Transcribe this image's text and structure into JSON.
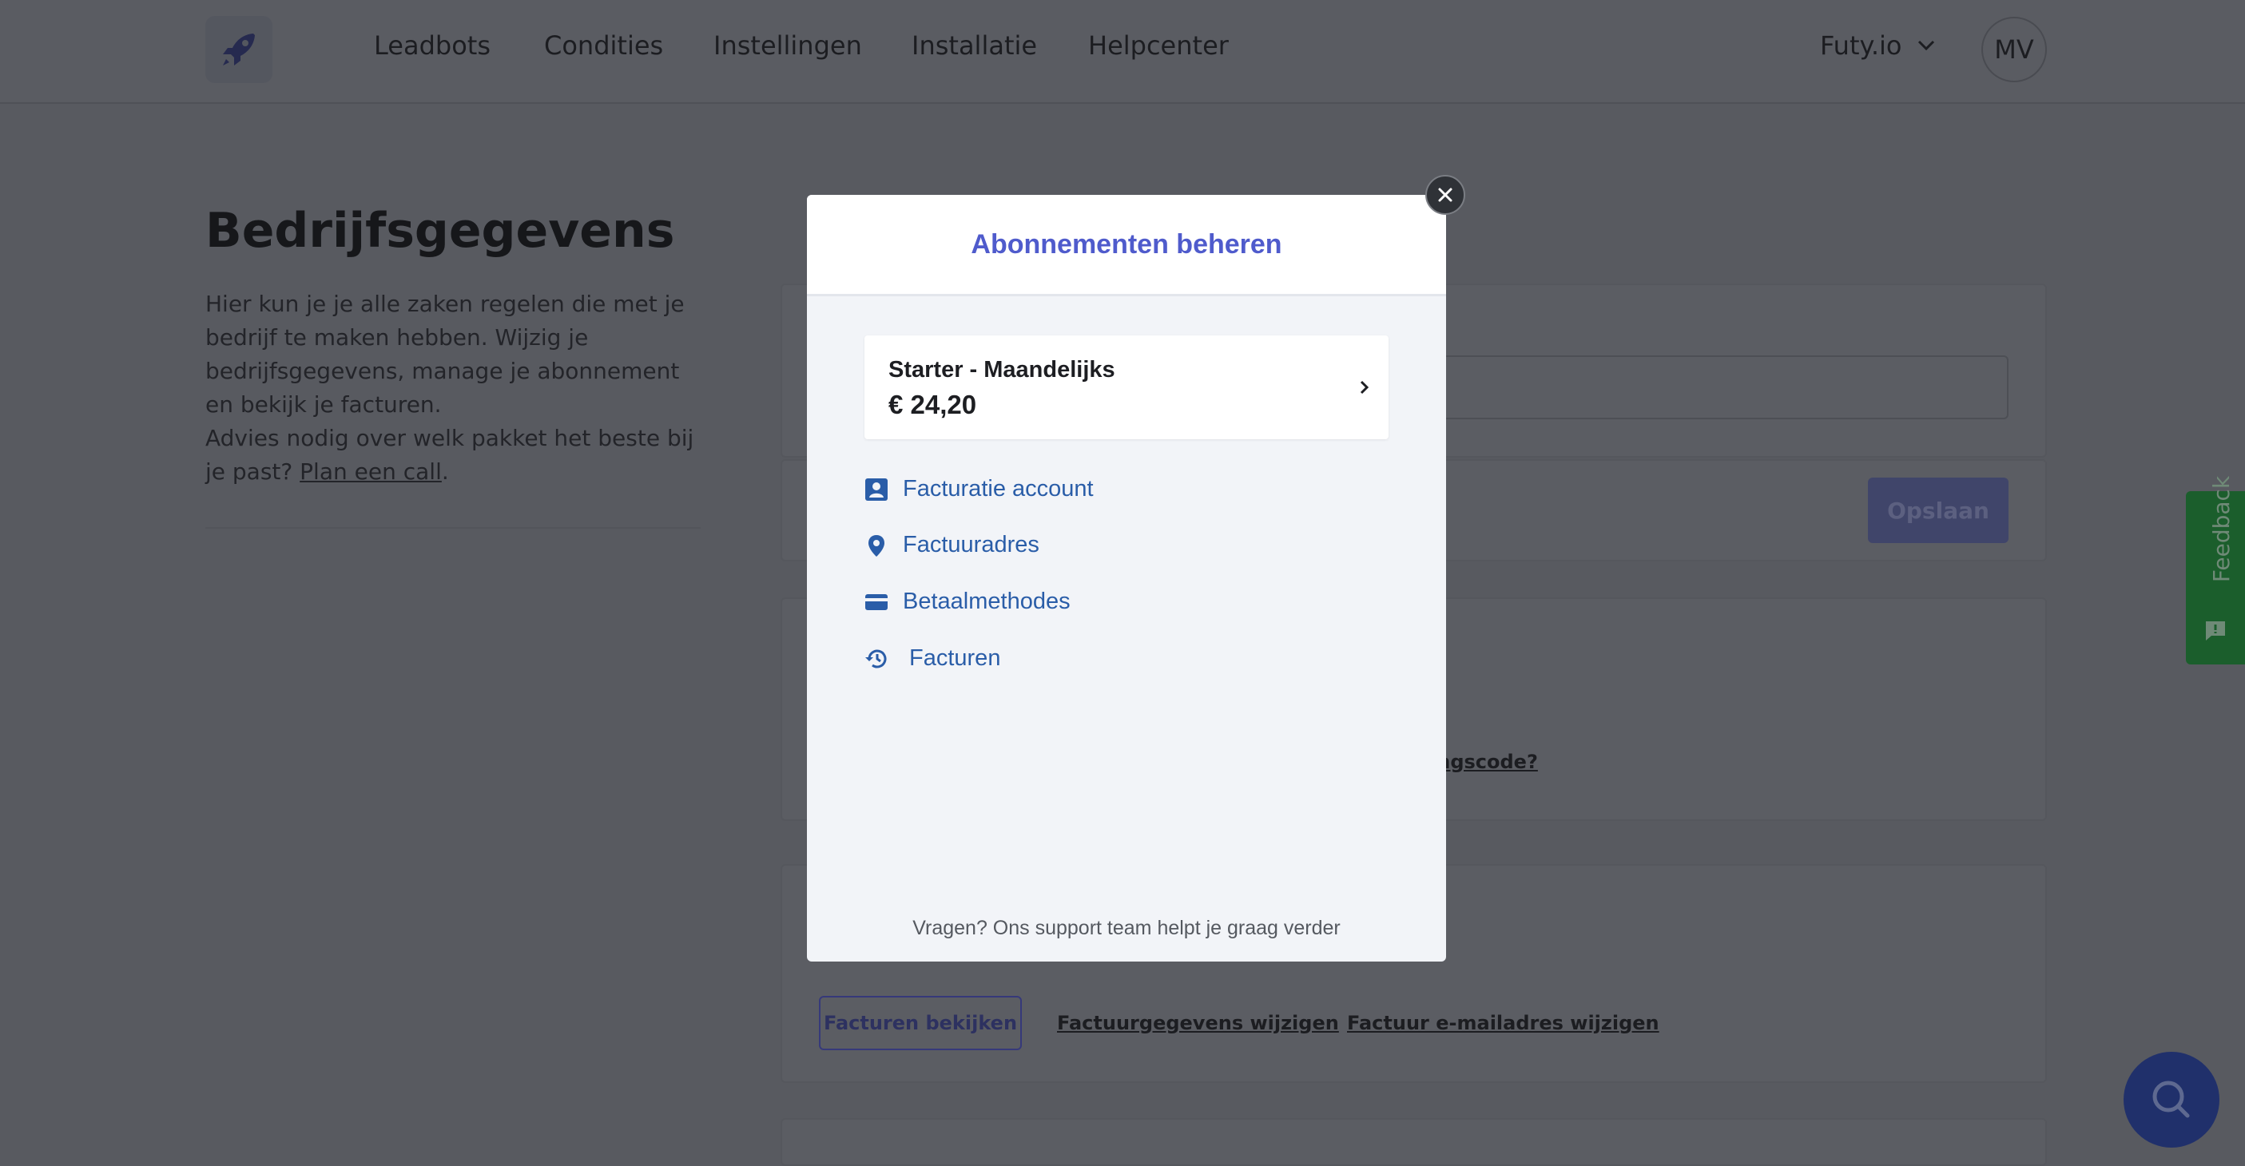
{
  "nav": {
    "links": [
      "Leadbots",
      "Condities",
      "Instellingen",
      "Installatie",
      "Helpcenter"
    ],
    "account_name": "Futy.io",
    "avatar_initials": "MV"
  },
  "page": {
    "title": "Bedrijfsgegevens",
    "intro": "Hier kun je je alle zaken regelen die met je bedrijf te maken hebben. Wijzig je bedrijfsgegevens, manage je abonnement en bekijk je facturen.",
    "advice_prefix": "Advies nodig over welk pakket het beste bij je past? ",
    "advice_link": "Plan een call",
    "advice_suffix": "."
  },
  "background": {
    "save_button": "Opslaan",
    "code_link_partial": "ingscode?",
    "view_invoices_button": "Facturen bekijken",
    "change_billing_link": "Factuurgegevens wijzigen",
    "change_email_link": "Factuur e-mailadres wijzigen"
  },
  "feedback": {
    "label": "Feedback",
    "color": "#1b5e2c"
  },
  "modal": {
    "title": "Abonnementen beheren",
    "plan": {
      "name": "Starter - Maandelijks",
      "price": "€ 24,20"
    },
    "menu": [
      {
        "label": "Facturatie account",
        "icon": "account-box-icon"
      },
      {
        "label": "Factuuradres",
        "icon": "location-pin-icon"
      },
      {
        "label": "Betaalmethodes",
        "icon": "credit-card-icon"
      },
      {
        "label": "Facturen",
        "icon": "history-icon"
      }
    ],
    "footer": "Vragen? Ons support team helpt je graag verder"
  },
  "colors": {
    "accent": "#4f5bcc",
    "link": "#2a5da8",
    "overlay_bg": "#585a60"
  }
}
